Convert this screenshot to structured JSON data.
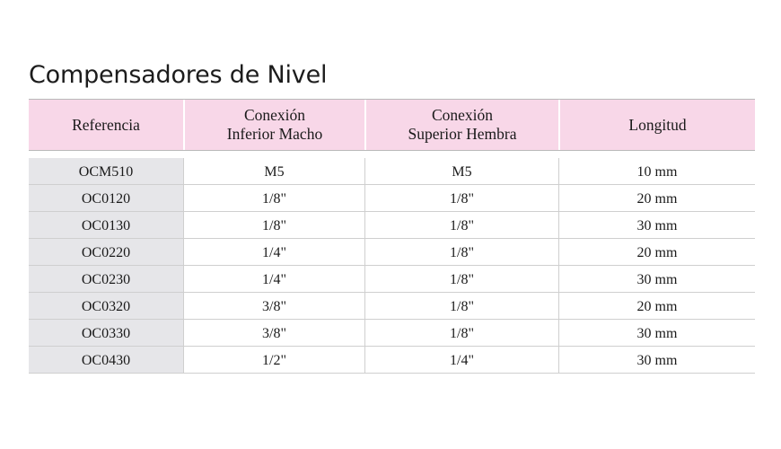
{
  "title": "Compensadores de Nivel",
  "table": {
    "headers": [
      {
        "line1": "Referencia",
        "line2": ""
      },
      {
        "line1": "Conexión",
        "line2": "Inferior Macho"
      },
      {
        "line1": "Conexión",
        "line2": "Superior Hembra"
      },
      {
        "line1": "Longitud",
        "line2": ""
      }
    ],
    "rows": [
      [
        "OCM510",
        "M5",
        "M5",
        "10 mm"
      ],
      [
        "OC0120",
        "1/8\"",
        "1/8\"",
        "20 mm"
      ],
      [
        "OC0130",
        "1/8\"",
        "1/8\"",
        "30 mm"
      ],
      [
        "OC0220",
        "1/4\"",
        "1/8\"",
        "20 mm"
      ],
      [
        "OC0230",
        "1/4\"",
        "1/8\"",
        "30 mm"
      ],
      [
        "OC0320",
        "3/8\"",
        "1/8\"",
        "20 mm"
      ],
      [
        "OC0330",
        "3/8\"",
        "1/8\"",
        "30 mm"
      ],
      [
        "OC0430",
        "1/2\"",
        "1/4\"",
        "30 mm"
      ]
    ]
  }
}
